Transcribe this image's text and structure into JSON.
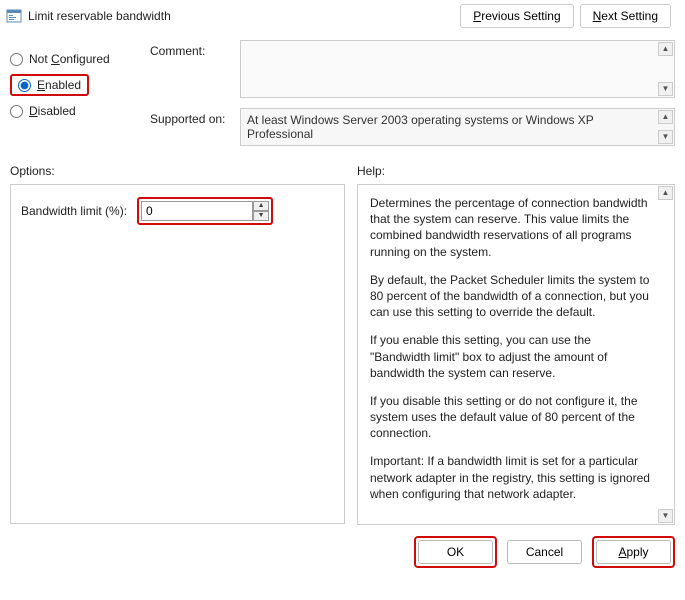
{
  "title": "Limit reservable bandwidth",
  "nav": {
    "previous": {
      "pre": "",
      "u": "P",
      "post": "revious Setting"
    },
    "next": {
      "pre": "",
      "u": "N",
      "post": "ext Setting"
    }
  },
  "radios": {
    "not_configured": {
      "pre": "Not ",
      "u": "C",
      "post": "onfigured",
      "checked": false
    },
    "enabled": {
      "pre": "",
      "u": "E",
      "post": "nabled",
      "checked": true
    },
    "disabled": {
      "pre": "",
      "u": "D",
      "post": "isabled",
      "checked": false
    }
  },
  "labels": {
    "comment": "Comment:",
    "supported_on": "Supported on:",
    "options": "Options:",
    "help": "Help:",
    "bandwidth_limit": "Bandwidth limit (%):"
  },
  "comment_text": "",
  "supported_on_text": "At least Windows Server 2003 operating systems or Windows XP Professional",
  "bandwidth_value": "0",
  "help_paragraphs": [
    "Determines the percentage of connection bandwidth that the system can reserve. This value limits the combined bandwidth reservations of all programs running on the system.",
    "By default, the Packet Scheduler limits the system to 80 percent of the bandwidth of a connection, but you can use this setting to override the default.",
    "If you enable this setting, you can use the \"Bandwidth limit\" box to adjust the amount of bandwidth the system can reserve.",
    "If you disable this setting or do not configure it, the system uses the default value of 80 percent of the connection.",
    "Important: If a bandwidth limit is set for a particular network adapter in the registry, this setting is ignored when configuring that network adapter."
  ],
  "buttons": {
    "ok": "OK",
    "cancel": "Cancel",
    "apply": {
      "pre": "",
      "u": "A",
      "post": "pply"
    }
  }
}
